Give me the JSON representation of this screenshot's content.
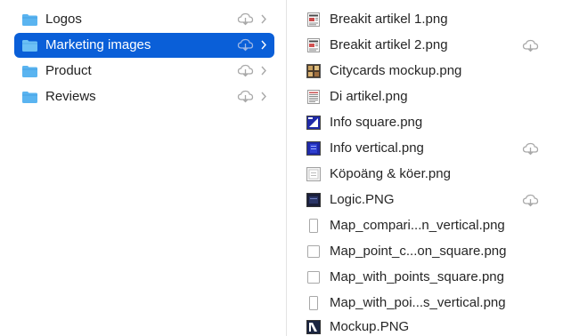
{
  "folders": [
    {
      "label": "Logos",
      "selected": false,
      "icon": "folder-icon"
    },
    {
      "label": "Marketing images",
      "selected": true,
      "icon": "folder-icon"
    },
    {
      "label": "Product",
      "selected": false,
      "icon": "folder-icon"
    },
    {
      "label": "Reviews",
      "selected": false,
      "icon": "folder-icon"
    }
  ],
  "files": [
    {
      "label": "Breakit artikel 1.png",
      "thumb": "document-thumbnail",
      "cloud": false
    },
    {
      "label": "Breakit artikel 2.png",
      "thumb": "document-thumbnail",
      "cloud": true
    },
    {
      "label": "Citycards mockup.png",
      "thumb": "photo-thumbnail",
      "cloud": false
    },
    {
      "label": "Di artikel.png",
      "thumb": "document-thumbnail",
      "cloud": false
    },
    {
      "label": "Info square.png",
      "thumb": "blue-image-thumbnail",
      "cloud": false
    },
    {
      "label": "Info vertical.png",
      "thumb": "blue-image-thumbnail",
      "cloud": true
    },
    {
      "label": "Köpoäng & köer.png",
      "thumb": "light-image-thumbnail",
      "cloud": false
    },
    {
      "label": "Logic.PNG",
      "thumb": "dark-image-thumbnail",
      "cloud": true
    },
    {
      "label": "Map_compari...n_vertical.png",
      "thumb": "blank-page-thumbnail",
      "cloud": false
    },
    {
      "label": "Map_point_c...on_square.png",
      "thumb": "blank-page-thumbnail",
      "cloud": false
    },
    {
      "label": "Map_with_points_square.png",
      "thumb": "blank-page-thumbnail",
      "cloud": false
    },
    {
      "label": "Map_with_poi...s_vertical.png",
      "thumb": "blank-page-thumbnail",
      "cloud": false
    },
    {
      "label": "Mockup.PNG",
      "thumb": "mockup-thumbnail",
      "cloud": false
    }
  ],
  "colors": {
    "selection": "#0a5fd8",
    "folder": "#5ab4f0",
    "icon_gray": "#a8a8a8"
  }
}
